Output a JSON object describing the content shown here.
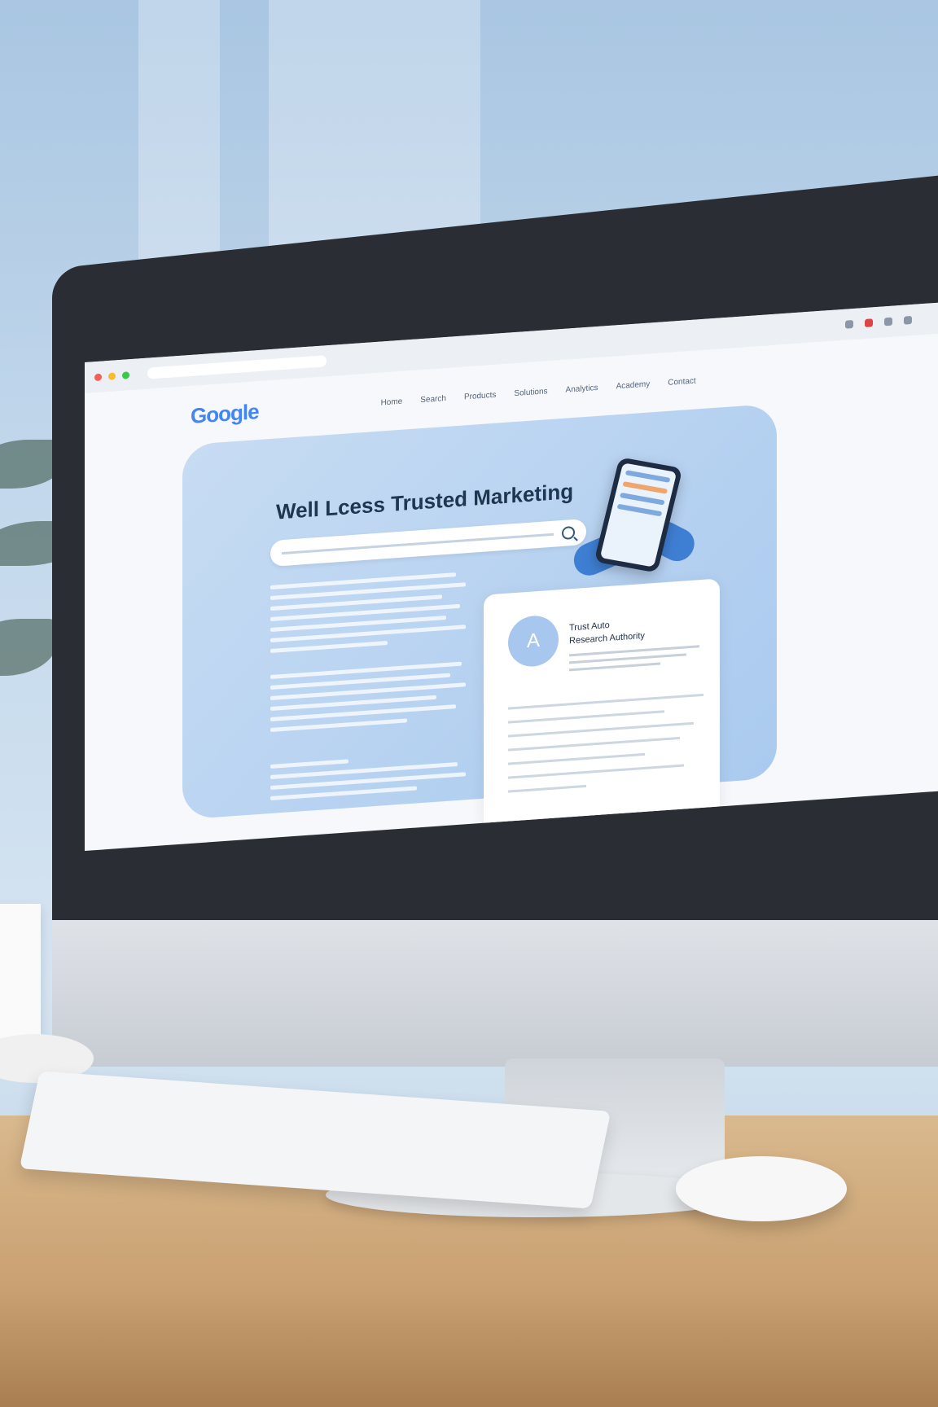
{
  "browser": {
    "logo_text": "Google",
    "nav_links": [
      "Home",
      "Search",
      "Products",
      "Solutions",
      "Analytics",
      "Academy",
      "Contact"
    ]
  },
  "hero": {
    "title": "Well Lcess Trusted Marketing"
  },
  "card": {
    "avatar_letter": "A",
    "title_line1": "Trust Auto",
    "title_line2": "Research Authority"
  }
}
